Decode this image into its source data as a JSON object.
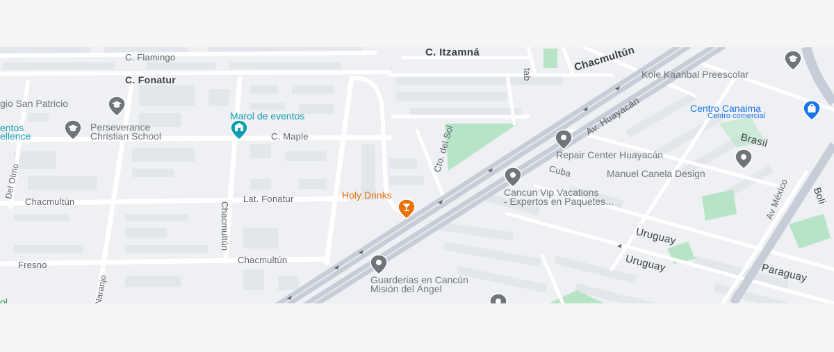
{
  "map": {
    "colors": {
      "background": "#eef0f3",
      "road": "#ffffff",
      "main_road": "#c6cdd7",
      "building": "#e3e6ea",
      "park": "#b7e4c7",
      "poi_gray": "#70757a",
      "poi_teal": "#129eaf",
      "poi_orange": "#e8710a",
      "poi_blue": "#1a73e8"
    },
    "streets": {
      "c_flamingo": "C. Flamingo",
      "c_itzamna": "C. Itzamná",
      "c_fonatur": "C. Fonatur",
      "chacmultun_top": "Chacmultún",
      "c_maple": "C. Maple",
      "av_huayacan": "Av. Huayacán",
      "brasil": "Brasil",
      "cto_del_sol": "Cto. del Sol",
      "cuba": "Cuba",
      "del_olmo": "Del Olmo",
      "chacmultun_left": "Chacmultún",
      "lat_fonatur": "Lat. Fonatur",
      "chacmultun_vertical": "Chacmultún",
      "fresno": "Fresno",
      "chacmultun_bottom": "Chacmultún",
      "naranjo": "Naranjo",
      "av_mexico": "Av México",
      "uruguay_1": "Uruguay",
      "uruguay_2": "Uruguay",
      "paraguay": "Paraguay",
      "bolivia_partial": "Boli",
      "tab_partial": "tab"
    },
    "places": {
      "san_patricio": "gio San Patricio",
      "eventos_partial_1": "entos",
      "eventos_partial_2": "ellence",
      "perseverance_1": "Perseverance",
      "perseverance_2": "Christian School",
      "marol": "Marol de eventos",
      "kole": "Kole Kaanbal Preescolar",
      "centro_canaima": "Centro Canaima",
      "centro_canaima_sub": "Centro comercial",
      "repair_center": "Repair Center Huayacán",
      "manuel_canela": "Manuel Canela Design",
      "cancun_vip_1": "Cancun Vip Vacations",
      "cancun_vip_2": "- Expertos en Paquetes...",
      "holy_drinks": "Holy Drinks",
      "guarderias_1": "Guarderias en Cancún",
      "guarderias_2": "Misión del Ángel",
      "ol_partial": "ol"
    },
    "icons": {
      "school": "school-icon",
      "event": "event-venue-icon",
      "bar": "cocktail-icon",
      "shopping": "shopping-bag-icon",
      "generic": "place-pin-icon"
    }
  }
}
